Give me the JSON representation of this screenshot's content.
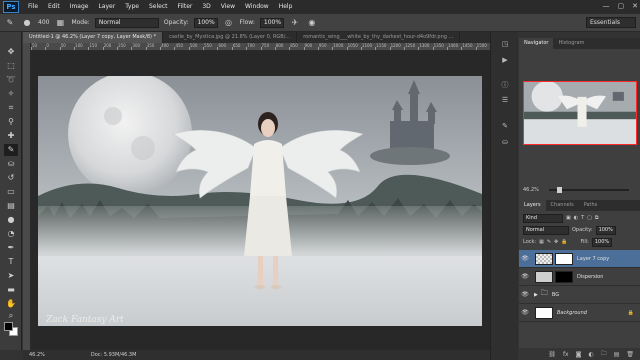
{
  "app": {
    "logo": "Ps"
  },
  "menu": [
    "File",
    "Edit",
    "Image",
    "Layer",
    "Type",
    "Select",
    "Filter",
    "3D",
    "View",
    "Window",
    "Help"
  ],
  "window_controls": [
    "—",
    "▢",
    "✕"
  ],
  "options": {
    "brush_size": "400",
    "mode_label": "Mode:",
    "mode_value": "Normal",
    "opacity_label": "Opacity:",
    "opacity_value": "100%",
    "flow_label": "Flow:",
    "flow_value": "100%",
    "workspace": "Essentials"
  },
  "doc_tabs": [
    {
      "label": "Untitled-1 @ 46.2% (Layer 7 copy, Layer Mask/8) *",
      "active": true
    },
    {
      "label": "castle_by_Mystica.jpg @ 21.8% (Layer 0, RGB/...",
      "active": false
    },
    {
      "label": "romantic_wing___white_by_thy_darkest_hour-d4o9fdr.png ...",
      "active": false
    }
  ],
  "ruler_ticks": [
    "50",
    "0",
    "50",
    "100",
    "150",
    "200",
    "250",
    "300",
    "350",
    "400",
    "450",
    "500",
    "550",
    "600",
    "650",
    "700",
    "750",
    "800",
    "850",
    "900",
    "950",
    "1000",
    "1050",
    "1100",
    "1150",
    "1200",
    "1250",
    "1300",
    "1350",
    "1400",
    "1450",
    "1500"
  ],
  "canvas": {
    "watermark": "Zack Fantasy Art"
  },
  "status": {
    "zoom": "46.2%",
    "doc": "Doc: 5.93M/46.3M"
  },
  "navigator": {
    "tabs": [
      "Navigator",
      "Histogram"
    ],
    "zoom": "46.2%",
    "zoom_level": 0.1
  },
  "layers_panel": {
    "tabs": [
      "Layers",
      "Channels",
      "Paths"
    ],
    "kind_label": "Kind",
    "blend_mode": "Normal",
    "opacity_label": "Opacity:",
    "opacity_value": "100%",
    "lock_label": "Lock:",
    "fill_label": "Fill:",
    "fill_value": "100%",
    "layers": [
      {
        "name": "Layer 7 copy",
        "selected": true,
        "type": "layer"
      },
      {
        "name": "Dispersion",
        "selected": false,
        "type": "layer"
      },
      {
        "name": "BG",
        "selected": false,
        "type": "group"
      },
      {
        "name": "Background",
        "selected": false,
        "type": "background"
      }
    ],
    "footer_icons": [
      "link-icon",
      "fx-icon",
      "mask-icon",
      "adjustment-icon",
      "folder-icon",
      "new-layer-icon",
      "trash-icon"
    ]
  }
}
